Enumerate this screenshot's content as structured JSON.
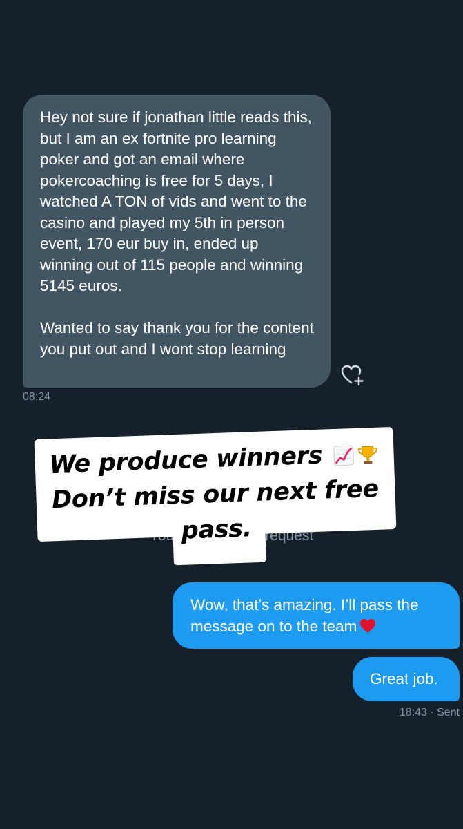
{
  "conversation": {
    "incoming": {
      "text": "Hey not sure if jonathan little reads this, but I am an ex fortnite pro learning poker and got an email where pokercoaching is free for 5 days, I watched A TON of vids and went to the casino and played my 5th in person event, 170 eur buy in, ended up winning out of 115 people and winning 5145 euros.\n\nWanted to say thank you for the content you put out and I wont stop learning",
      "time": "08:24",
      "react_icon": "heart-plus-icon"
    },
    "request_notice": "You accepted the request",
    "outgoing": [
      {
        "text": "Wow, that’s amazing. I’ll pass the message on to the team",
        "emoji": "red-heart"
      },
      {
        "text": "Great job."
      }
    ],
    "outgoing_meta": "18:43 · Sent"
  },
  "promo": {
    "line1": "We produce winners",
    "line2": "Don’t miss our next free",
    "line3": "pass.",
    "emojis": [
      "chart-increasing-icon",
      "trophy-icon"
    ]
  },
  "colors": {
    "background": "#15202b",
    "incoming_bubble": "#425563",
    "outgoing_bubble": "#1d9bf0",
    "meta_text": "#8b98a5",
    "promo_card": "#ffffff"
  }
}
